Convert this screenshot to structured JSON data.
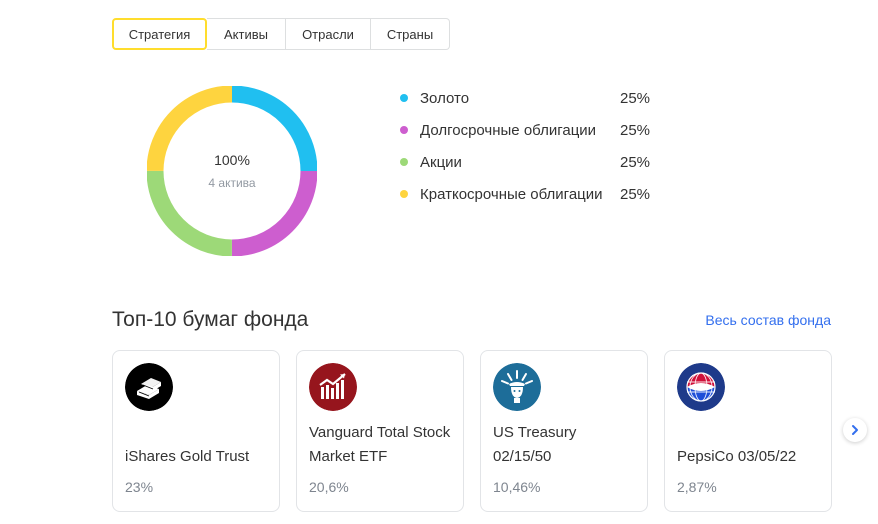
{
  "tabs": [
    {
      "label": "Стратегия",
      "active": true
    },
    {
      "label": "Активы",
      "active": false
    },
    {
      "label": "Отрасли",
      "active": false
    },
    {
      "label": "Страны",
      "active": false
    }
  ],
  "allocation": {
    "total_label": "100%",
    "count_label": "4 актива",
    "items": [
      {
        "label": "Золото",
        "value": "25%",
        "share": 25,
        "color": "#20bff0"
      },
      {
        "label": "Долгосрочные облигации",
        "value": "25%",
        "share": 25,
        "color": "#cd5ecf"
      },
      {
        "label": "Акции",
        "value": "25%",
        "share": 25,
        "color": "#9dd978"
      },
      {
        "label": "Краткосрочные облигации",
        "value": "25%",
        "share": 25,
        "color": "#fed43f"
      }
    ]
  },
  "top_holdings": {
    "title": "Топ-10 бумаг фонда",
    "all_link": "Весь состав фонда",
    "cards": [
      {
        "name": "iShares Gold Trust",
        "share": "23%",
        "icon": "gold-bars-icon"
      },
      {
        "name": "Vanguard Total Stock Market ETF",
        "share": "20,6%",
        "icon": "vanguard-logo-icon"
      },
      {
        "name": "US Treasury 02/15/50",
        "share": "10,46%",
        "icon": "statue-of-liberty-icon"
      },
      {
        "name": "PepsiCo 03/05/22",
        "share": "2,87%",
        "icon": "pepsico-globe-icon"
      }
    ]
  },
  "icons": {
    "next": "chevron-right-icon"
  }
}
